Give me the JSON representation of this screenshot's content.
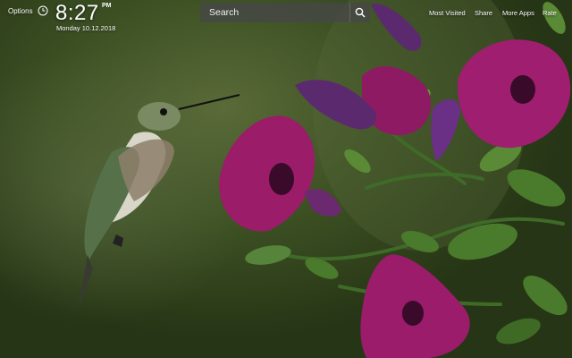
{
  "header": {
    "options_label": "Options",
    "time": "8:27",
    "ampm": "PM",
    "date": "Monday  10.12.2018"
  },
  "search": {
    "placeholder": "Search"
  },
  "nav": {
    "items": [
      "Most Visited",
      "Share",
      "More Apps",
      "Rate"
    ]
  },
  "icons": {
    "clock": "clock-icon",
    "search": "search-icon"
  },
  "colors": {
    "background": "#34461f",
    "petal": "#9b1c68",
    "search_box": "#464646"
  }
}
